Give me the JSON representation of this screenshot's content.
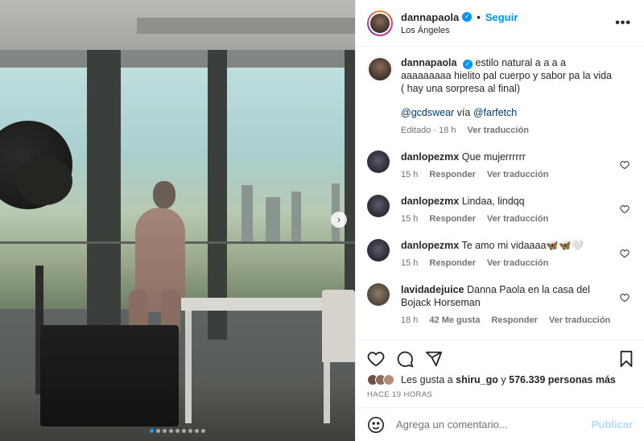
{
  "post": {
    "username": "dannapaola",
    "follow_label": "Seguir",
    "separator": "•",
    "location": "Los Ángeles",
    "more_label": "•••",
    "verified_glyph": "✓"
  },
  "caption": {
    "username": "dannapaola",
    "text": "estilo natural a a a a aaaaaaaaa hielito pal cuerpo y sabor pa la vida ( hay una sorpresa al final)",
    "mention1": "@gcdswear",
    "via": "vía",
    "mention2": "@farfetch",
    "meta_edited": "Editado · 18 h",
    "meta_translate": "Ver traducción"
  },
  "comments": [
    {
      "username": "danlopezmx",
      "text": "Que mujerrrrrr",
      "time": "15 h",
      "reply": "Responder",
      "translate": "Ver traducción",
      "likes": ""
    },
    {
      "username": "danlopezmx",
      "text": "Lindaa, lindqq",
      "time": "15 h",
      "reply": "Responder",
      "translate": "Ver traducción",
      "likes": ""
    },
    {
      "username": "danlopezmx",
      "text": "Te amo mi vidaaaa🦋🦋🤍",
      "time": "15 h",
      "reply": "Responder",
      "translate": "Ver traducción",
      "likes": ""
    },
    {
      "username": "lavidadejuice",
      "text": "Danna Paola en la casa del Bojack Horseman",
      "time": "18 h",
      "reply": "Responder",
      "translate": "Ver traducción",
      "likes": "42 Me gusta"
    }
  ],
  "likes": {
    "prefix": "Les gusta a",
    "user": "shiru_go",
    "conj": "y",
    "count": "576.339 personas más"
  },
  "timestamp": "HACE 19 HORAS",
  "composer": {
    "placeholder": "Agrega un comentario...",
    "publish_label": "Publicar"
  },
  "carousel": {
    "current": 1,
    "total": 9,
    "next_glyph": "›"
  },
  "icons": [
    "heart-icon",
    "comment-icon",
    "share-icon",
    "bookmark-icon",
    "emoji-icon",
    "more-icon",
    "verified-icon"
  ],
  "colors": {
    "accent": "#0095f6",
    "text": "#262626",
    "muted": "#737373",
    "publish_disabled": "#b3dbff"
  }
}
